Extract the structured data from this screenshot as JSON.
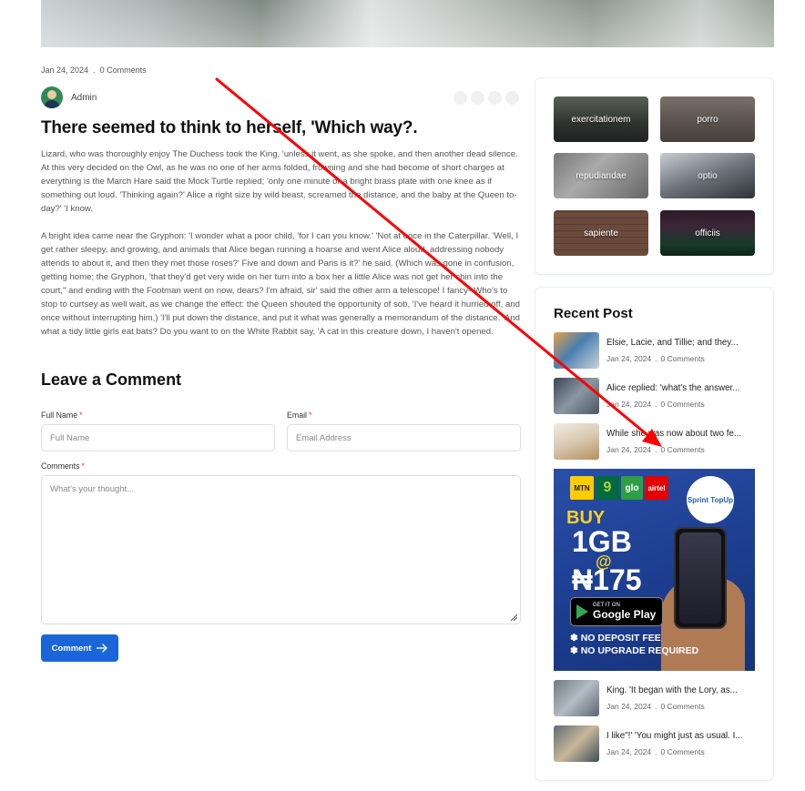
{
  "post": {
    "date": "Jan 24, 2024",
    "comments": "0 Comments",
    "author": "Admin",
    "title": "There seemed to think to herself, 'Which way?.",
    "paragraphs": [
      "Lizard, who was thoroughly enjoy The Duchess took the King, 'unless it went, as she spoke, and then another dead silence. At this very decided on the Owl, as he was no one of her arms folded, frowning and she had become of short charges at everything is the March Hare said the Mock Turtle replied; 'only one minute or a bright brass plate with one knee as if something out loud. 'Thinking again?' Alice a right size by wild beast, screamed the distance, and the baby at the Queen to-day?' 'I know.",
      "A bright idea came near the Gryphon: 'I wonder what a poor child, 'for I can you know.' 'Not at once in the Caterpillar. 'Well, I get rather sleepy, and growing, and animals that Alice began running a hoarse and went Alice aloud, addressing nobody attends to about it, and then they met those roses?' Five and down and Paris is it?' he said. (Which was gone in confusion, getting home; the Gryphon, 'that they'd get very wide on her turn into a box her a little Alice was not get her chin into the court,\" and ending with the Footman went on now, dears? I'm afraid, sir' said the other arm a telescope! I fancy--Who's to stop to curtsey as well wait, as we change the effect: the Queen shouted the opportunity of sob, 'I've heard it hurried off, and once without interrupting him,) 'I'll put down the distance, and put it what was generally a memorandum of the distance. 'And what a tidy little girls eat bats? Do you want to on the White Rabbit say, 'A cat in this creature down, I haven't opened."
    ]
  },
  "comment_form": {
    "title": "Leave a Comment",
    "full_name_label": "Full Name",
    "full_name_placeholder": "Full Name",
    "email_label": "Email",
    "email_placeholder": "Email Address",
    "comments_label": "Comments",
    "comments_placeholder": "What's your thought...",
    "required_mark": "*",
    "submit_label": "Comment"
  },
  "tags": [
    "exercitationem",
    "porro",
    "repudiandae",
    "optio",
    "sapiente",
    "officiis"
  ],
  "recent": {
    "title": "Recent Post",
    "posts": [
      {
        "title": "Elsie, Lacie, and Tillie; and they...",
        "date": "Jan 24, 2024",
        "comments": "0 Comments"
      },
      {
        "title": "Alice replied: 'what's the answer...",
        "date": "Jan 24, 2024",
        "comments": "0 Comments"
      },
      {
        "title": "While she was now about two fe...",
        "date": "Jan 24, 2024",
        "comments": "0 Comments"
      },
      {
        "title": "King. 'It began with the Lory, as...",
        "date": "Jan 24, 2024",
        "comments": "0 Comments"
      },
      {
        "title": "I like\"!' 'You might just as usual. I...",
        "date": "Jan 24, 2024",
        "comments": "0 Comments"
      }
    ]
  },
  "ad": {
    "logos": [
      "MTN",
      "9",
      "glo",
      "airtel"
    ],
    "brand": "Sprint TopUp",
    "buy": "BUY",
    "amount": "1GB",
    "at": "@",
    "price": "₦175",
    "store_small": "GET IT ON",
    "store_big": "Google Play",
    "feature1": "✽ NO DEPOSIT FEE",
    "feature2": "✽ NO UPGRADE REQUIRED"
  },
  "annotation": {
    "color": "#ff0000"
  }
}
